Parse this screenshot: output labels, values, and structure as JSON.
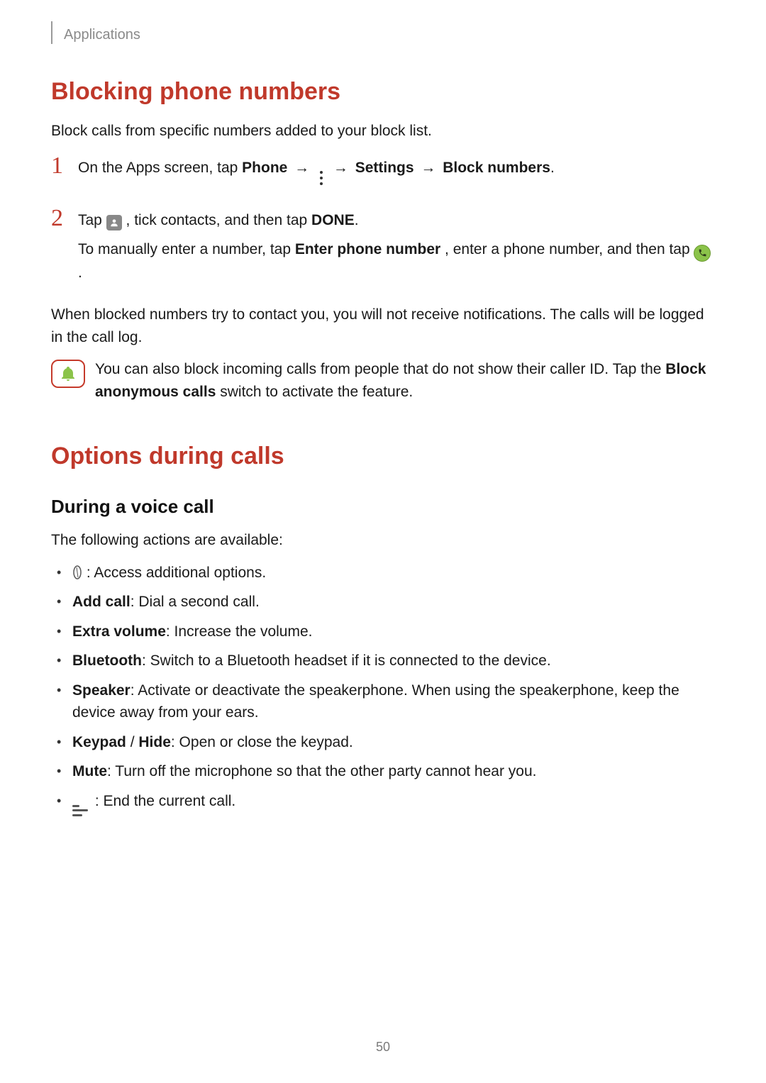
{
  "header": {
    "section": "Applications"
  },
  "section1": {
    "title": "Blocking phone numbers",
    "intro": "Block calls from specific numbers added to your block list.",
    "step1": {
      "pre": "On the Apps screen, tap ",
      "b1": "Phone",
      "arrow": "→",
      "b2": "Settings",
      "b3": "Block numbers",
      "period": "."
    },
    "step2": {
      "line1_pre": "Tap ",
      "line1_mid": ", tick contacts, and then tap ",
      "line1_b": "DONE",
      "line1_end": ".",
      "line2_pre": "To manually enter a number, tap ",
      "line2_b": "Enter phone number",
      "line2_mid": ", enter a phone number, and then tap ",
      "line2_end": "."
    },
    "after": "When blocked numbers try to contact you, you will not receive notifications. The calls will be logged in the call log.",
    "note_pre": "You can also block incoming calls from people that do not show their caller ID. Tap the ",
    "note_b": "Block anonymous calls",
    "note_post": " switch to activate the feature."
  },
  "section2": {
    "title": "Options during calls",
    "sub": "During a voice call",
    "intro": "The following actions are available:",
    "bullets": {
      "b1": " : Access additional options.",
      "b2_b": "Add call",
      "b2_t": ": Dial a second call.",
      "b3_b": "Extra volume",
      "b3_t": ": Increase the volume.",
      "b4_b": "Bluetooth",
      "b4_t": ": Switch to a Bluetooth headset if it is connected to the device.",
      "b5_b": "Speaker",
      "b5_t": ": Activate or deactivate the speakerphone. When using the speakerphone, keep the device away from your ears.",
      "b6_b1": "Keypad",
      "b6_sep": " / ",
      "b6_b2": "Hide",
      "b6_t": ": Open or close the keypad.",
      "b7_b": "Mute",
      "b7_t": ": Turn off the microphone so that the other party cannot hear you.",
      "b8": " : End the current call."
    }
  },
  "page_number": "50"
}
